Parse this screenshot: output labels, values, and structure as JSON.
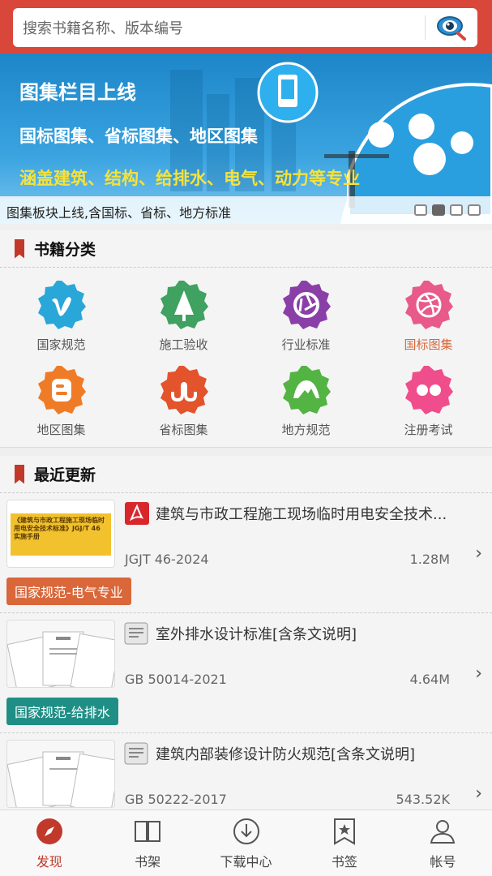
{
  "search": {
    "placeholder": "搜索书籍名称、版本编号",
    "icon": "search-eye-icon"
  },
  "banner": {
    "title": "图集栏目上线",
    "subtitle": "国标图集、省标图集、地区图集",
    "highlight": "涵盖建筑、结构、给排水、电气、动力等专业",
    "caption": "图集板块上线,含国标、省标、地方标准",
    "active_dot": 1,
    "dot_count": 4
  },
  "categories": {
    "title": "书籍分类",
    "items": [
      {
        "label": "国家规范",
        "icon": "vimeo-icon",
        "color": "#29a7d8"
      },
      {
        "label": "施工验收",
        "icon": "tree-icon",
        "color": "#3fa260"
      },
      {
        "label": "行业标准",
        "icon": "camera-aperture-icon",
        "color": "#8a3fa8"
      },
      {
        "label": "国标图集",
        "icon": "dribbble-icon",
        "color": "#e85a8a",
        "active": true
      },
      {
        "label": "地区图集",
        "icon": "blogger-icon",
        "color": "#f07b26"
      },
      {
        "label": "省标图集",
        "icon": "stumbleupon-icon",
        "color": "#e3532c"
      },
      {
        "label": "地方规范",
        "icon": "mountain-icon",
        "color": "#53b343"
      },
      {
        "label": "注册考试",
        "icon": "flickr-icon",
        "color": "#f04d8c"
      }
    ]
  },
  "recent": {
    "title": "最近更新",
    "items": [
      {
        "title": "建筑与市政工程施工现场临时用电安全技术...",
        "code": "JGJT 46-2024",
        "size": "1.28M",
        "tag": "国家规范-电气专业",
        "tag_color": "#d9673a",
        "file_icon": "pdf-icon",
        "thumb_text": "《建筑与市政工程施工现场临时用电安全技术标准》JGJ/T 46 实施手册"
      },
      {
        "title": "室外排水设计标准[含条文说明]",
        "code": "GB 50014-2021",
        "size": "4.64M",
        "tag": "国家规范-给排水",
        "tag_color": "#1f8f86",
        "file_icon": "document-icon"
      },
      {
        "title": "建筑内部装修设计防火规范[含条文说明]",
        "code": "GB 50222-2017",
        "size": "543.52K",
        "file_icon": "document-icon"
      }
    ]
  },
  "tabs": [
    {
      "label": "发现",
      "icon": "compass-icon",
      "active": true
    },
    {
      "label": "书架",
      "icon": "book-icon"
    },
    {
      "label": "下载中心",
      "icon": "download-icon"
    },
    {
      "label": "书签",
      "icon": "bookmark-star-icon"
    },
    {
      "label": "帐号",
      "icon": "user-icon"
    }
  ],
  "colors": {
    "brand": "#d9473a",
    "accent": "#c0392b"
  }
}
